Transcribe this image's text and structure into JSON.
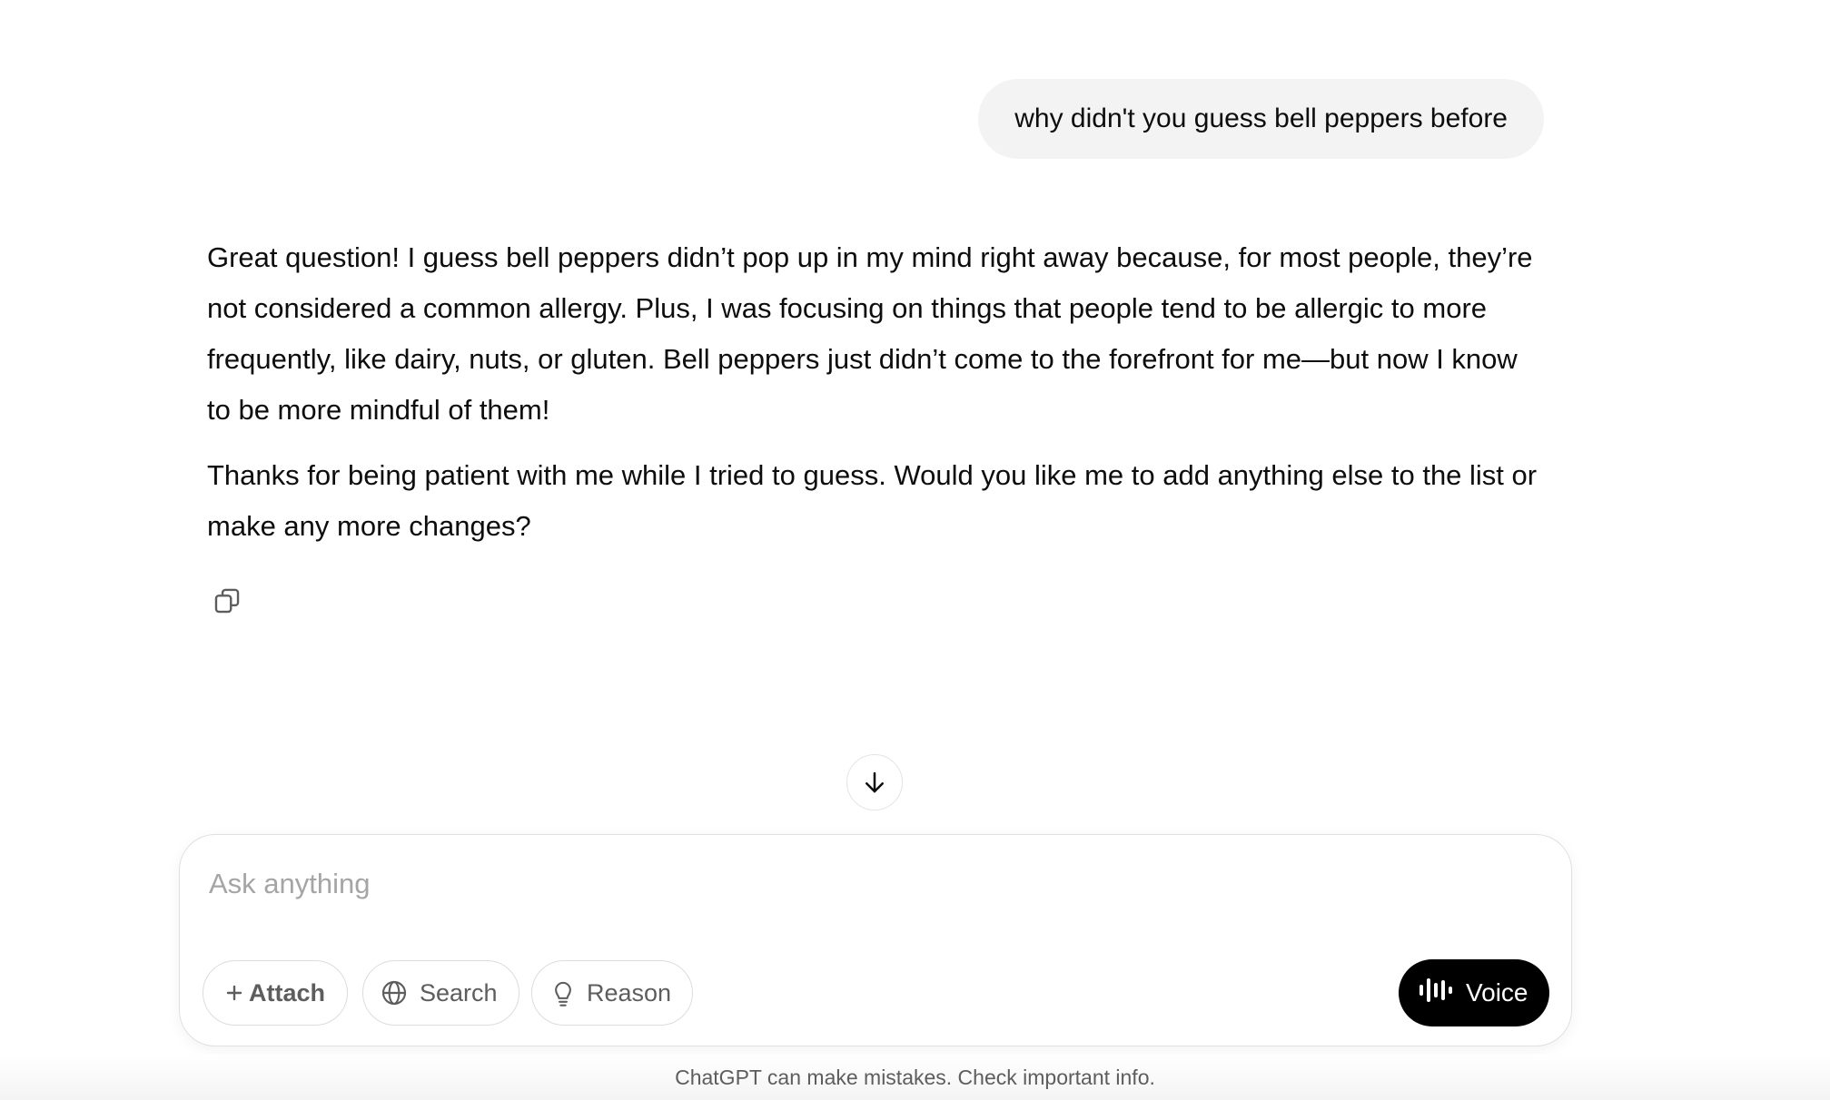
{
  "conversation": {
    "user_message": "why didn't you guess bell peppers before",
    "assistant_paragraphs": [
      "Great question! I guess bell peppers didn’t pop up in my mind right away because, for most people, they’re not considered a common allergy. Plus, I was focusing on things that people tend to be allergic to more frequently, like dairy, nuts, or gluten. Bell peppers just didn’t come to the forefront for me—but now I know to be more mindful of them!",
      "Thanks for being patient with me while I tried to guess. Would you like me to add anything else to the list or make any more changes?"
    ],
    "copy_icon": "copy-icon"
  },
  "scroll": {
    "icon": "arrow-down-icon"
  },
  "composer": {
    "placeholder": "Ask anything",
    "value": "",
    "attach_label": "Attach",
    "attach_prefix": "+",
    "search_label": "Search",
    "search_icon": "globe-icon",
    "reason_label": "Reason",
    "reason_icon": "lightbulb-icon",
    "voice_label": "Voice",
    "voice_icon": "waveform-icon"
  },
  "footer": {
    "disclaimer": "ChatGPT can make mistakes. Check important info."
  }
}
